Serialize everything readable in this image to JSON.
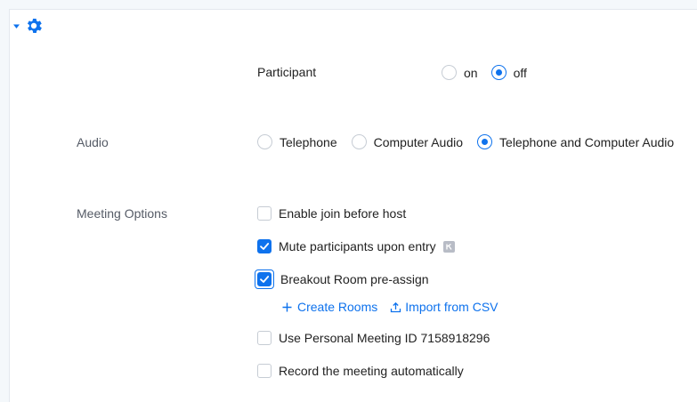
{
  "header": {
    "collapse_icon": "caret-down-icon",
    "settings_icon": "gear-icon"
  },
  "participant": {
    "label": "Participant",
    "options": [
      {
        "label": "on",
        "checked": false
      },
      {
        "label": "off",
        "checked": true
      }
    ]
  },
  "audio": {
    "label": "Audio",
    "options": [
      {
        "label": "Telephone",
        "checked": false
      },
      {
        "label": "Computer Audio",
        "checked": false
      },
      {
        "label": "Telephone and Computer Audio",
        "checked": true
      }
    ]
  },
  "meeting_options": {
    "label": "Meeting Options",
    "items": [
      {
        "label": "Enable join before host",
        "checked": false
      },
      {
        "label": "Mute participants upon entry",
        "checked": true,
        "info_icon": "info-badge-icon"
      },
      {
        "label": "Breakout Room pre-assign",
        "checked": true
      },
      {
        "label": "Use Personal Meeting ID 7158918296",
        "checked": false
      },
      {
        "label": "Record the meeting automatically",
        "checked": false
      }
    ],
    "breakout_links": {
      "create_rooms": "Create Rooms",
      "import_csv": "Import from CSV",
      "create_icon": "plus-icon",
      "import_icon": "upload-icon"
    }
  },
  "colors": {
    "accent": "#0e72ed",
    "label_gray": "#555b66",
    "border": "#c6ccd4",
    "background": "#f4f8fb"
  }
}
